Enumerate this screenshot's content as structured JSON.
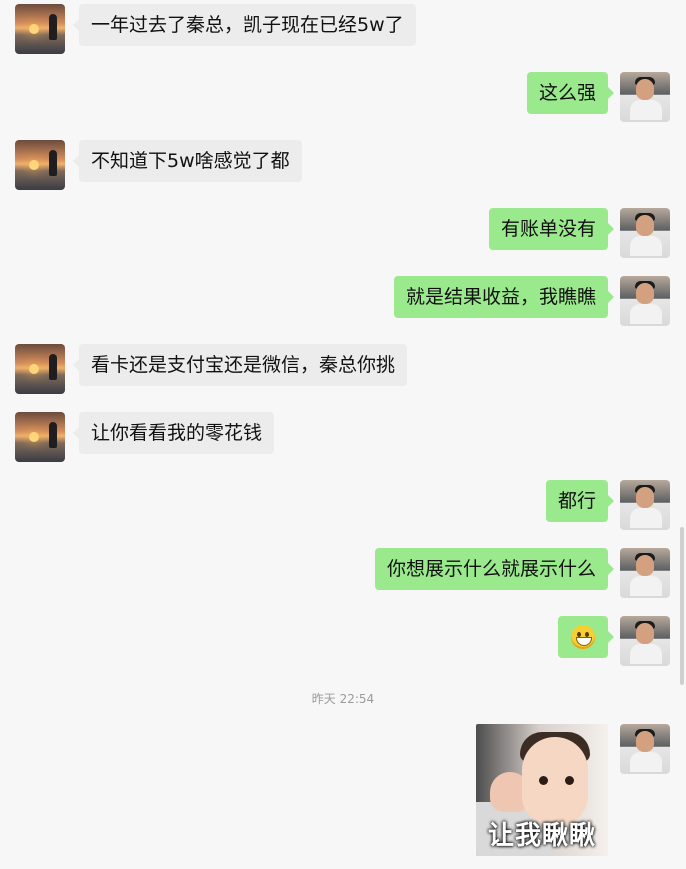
{
  "messages": [
    {
      "side": "left",
      "text": "一年过去了秦总，凯子现在已经5w了"
    },
    {
      "side": "right",
      "text": "这么强"
    },
    {
      "side": "left",
      "text": "不知道下5w啥感觉了都"
    },
    {
      "side": "right",
      "text": "有账单没有"
    },
    {
      "side": "right",
      "text": "就是结果收益，我瞧瞧"
    },
    {
      "side": "left",
      "text": "看卡还是支付宝还是微信，秦总你挑"
    },
    {
      "side": "left",
      "text": "让你看看我的零花钱"
    },
    {
      "side": "right",
      "text": "都行"
    },
    {
      "side": "right",
      "text": "你想展示什么就展示什么"
    },
    {
      "side": "right",
      "emoji": "grinning-face-emoji"
    }
  ],
  "timestamp": "昨天 22:54",
  "image_message": {
    "caption": "让我瞅瞅"
  },
  "colors": {
    "background": "#f7f7f7",
    "left_bubble": "#ececec",
    "right_bubble": "#9be98d",
    "text": "#111111",
    "timestamp": "#9b9b9b"
  },
  "icons": {
    "left_avatar": "sunset-avatar-icon",
    "right_avatar": "man-avatar-icon",
    "emoji": "grinning-face-icon"
  }
}
